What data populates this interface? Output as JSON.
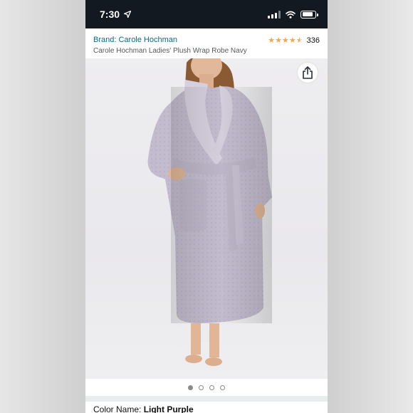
{
  "status_bar": {
    "time": "7:30",
    "location_icon": "location-arrow-icon",
    "signal_icon": "cellular-signal-icon",
    "wifi_icon": "wifi-icon",
    "battery_icon": "battery-icon",
    "battery_level": 0.85
  },
  "product": {
    "brand": "Brand: Carole Hochman",
    "title": "Carole Hochman Ladies' Plush Wrap Robe Navy",
    "rating": 4.5,
    "rating_count": "336",
    "share_icon": "share-icon"
  },
  "gallery": {
    "image_count": 4,
    "active_index": 0
  },
  "variation": {
    "color_label": "Color Name: ",
    "color_value": "Light Purple"
  },
  "colors": {
    "status_bar_bg": "#131921",
    "brand_link": "#007185",
    "star": "#f3a847",
    "robe": "#c3bccd"
  }
}
